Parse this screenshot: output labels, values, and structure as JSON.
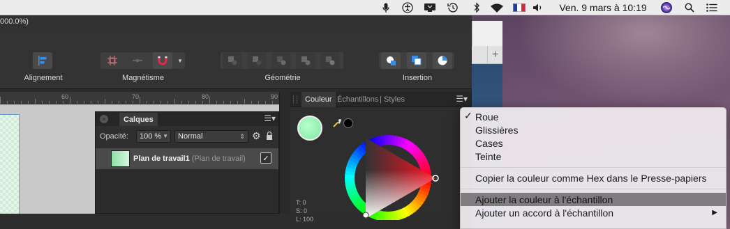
{
  "menubar": {
    "date": "Ven. 9 mars à 10:19",
    "icons": [
      "microphone-icon",
      "accessibility-icon",
      "display-icon",
      "time-machine-icon",
      "bluetooth-icon",
      "wifi-icon",
      "flag-fr-icon",
      "volume-icon",
      "siri-icon",
      "spotlight-icon",
      "list-icon"
    ]
  },
  "app": {
    "title_fragment": "000.0%)",
    "toolbar": {
      "alignment_label": "Alignement",
      "snapping_label": "Magnétisme",
      "geometry_label": "Géométrie",
      "insertion_label": "Insertion"
    }
  },
  "ruler": {
    "ticks": [
      "60",
      "70",
      "80",
      "90"
    ]
  },
  "layers": {
    "tab_label": "Calques",
    "opacity_label": "Opacité:",
    "opacity_value": "100 %",
    "blend_mode": "Normal",
    "layer_name": "Plan de travail1",
    "layer_type": "(Plan de travail)"
  },
  "color_panel": {
    "tabs": [
      "Couleur",
      "Échantillons",
      "Styles"
    ],
    "t_value": "T: 0",
    "s_value": "S: 0",
    "l_value": "L: 100"
  },
  "context_menu": {
    "items": [
      {
        "label": "Roue",
        "checked": true
      },
      {
        "label": "Glissières",
        "checked": false
      },
      {
        "label": "Cases",
        "checked": false
      },
      {
        "label": "Teinte",
        "checked": false
      },
      {
        "label": "Copier la couleur comme Hex dans le Presse-papiers",
        "checked": false
      },
      {
        "label": "Ajouter la couleur à l'échantillon",
        "checked": false,
        "highlighted": true
      },
      {
        "label": "Ajouter un accord à l'échantillon",
        "checked": false,
        "submenu": true
      }
    ],
    "check_glyph": "✓",
    "submenu_glyph": "▶"
  },
  "colors": {
    "accent_swatch": "#8ee8a8",
    "wallpaper": "#6b4f6c",
    "highlight": "#7f7d7f"
  }
}
